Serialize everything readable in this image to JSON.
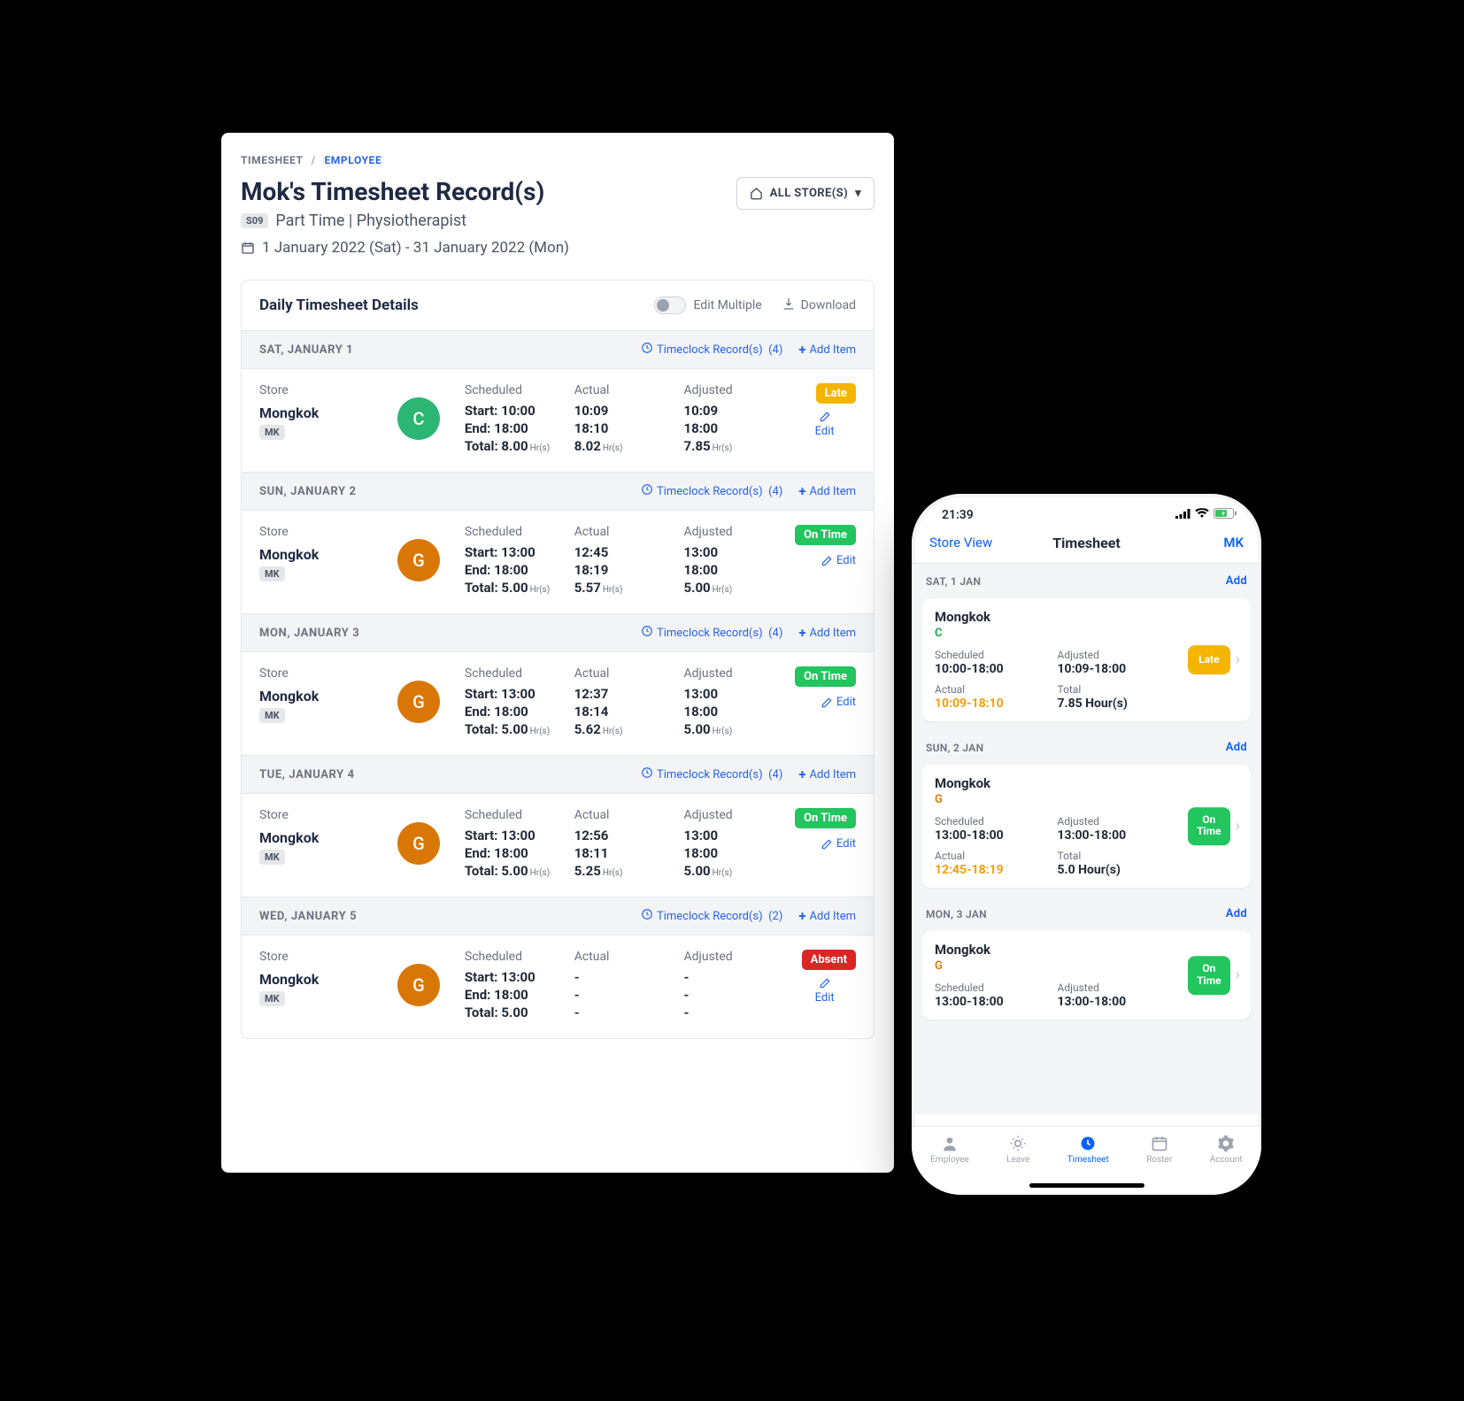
{
  "breadcrumb": {
    "ts": "TIMESHEET",
    "emp": "EMPLOYEE"
  },
  "title": "Mok's Timesheet Record(s)",
  "emp_id": "S09",
  "subtitle": "Part Time | Physiotherapist",
  "date_range": "1 January 2022 (Sat) - 31 January 2022 (Mon)",
  "store_filter": "ALL STORE(S)",
  "card": {
    "title": "Daily Timesheet Details",
    "edit_multiple": "Edit Multiple",
    "download": "Download"
  },
  "labels": {
    "store": "Store",
    "scheduled": "Scheduled",
    "actual": "Actual",
    "adjusted": "Adjusted",
    "start": "Start:",
    "end": "End:",
    "total": "Total:",
    "edit": "Edit",
    "add_item": "Add Item",
    "timeclock_prefix": "Timeclock Record(s)",
    "hrs": "Hr(s)"
  },
  "days": [
    {
      "header": "SAT, JANUARY 1",
      "tc_count": "(4)",
      "store": "Mongkok",
      "store_code": "MK",
      "avatar": "C",
      "avatar_class": "av-green",
      "scheduled": {
        "start": "10:00",
        "end": "18:00",
        "total": "8.00"
      },
      "actual": {
        "start": "10:09",
        "end": "18:10",
        "total": "8.02"
      },
      "adjusted": {
        "start": "10:09",
        "end": "18:00",
        "total": "7.85"
      },
      "status": "Late",
      "status_class": "late",
      "edit_stacked": true
    },
    {
      "header": "SUN, JANUARY 2",
      "tc_count": "(4)",
      "store": "Mongkok",
      "store_code": "MK",
      "avatar": "G",
      "avatar_class": "av-orange",
      "scheduled": {
        "start": "13:00",
        "end": "18:00",
        "total": "5.00"
      },
      "actual": {
        "start": "12:45",
        "end": "18:19",
        "total": "5.57"
      },
      "adjusted": {
        "start": "13:00",
        "end": "18:00",
        "total": "5.00"
      },
      "status": "On Time",
      "status_class": "ontime",
      "edit_stacked": false
    },
    {
      "header": "MON, JANUARY 3",
      "tc_count": "(4)",
      "store": "Mongkok",
      "store_code": "MK",
      "avatar": "G",
      "avatar_class": "av-orange",
      "scheduled": {
        "start": "13:00",
        "end": "18:00",
        "total": "5.00"
      },
      "actual": {
        "start": "12:37",
        "end": "18:14",
        "total": "5.62"
      },
      "adjusted": {
        "start": "13:00",
        "end": "18:00",
        "total": "5.00"
      },
      "status": "On Time",
      "status_class": "ontime",
      "edit_stacked": false
    },
    {
      "header": "TUE, JANUARY 4",
      "tc_count": "(4)",
      "store": "Mongkok",
      "store_code": "MK",
      "avatar": "G",
      "avatar_class": "av-orange",
      "scheduled": {
        "start": "13:00",
        "end": "18:00",
        "total": "5.00"
      },
      "actual": {
        "start": "12:56",
        "end": "18:11",
        "total": "5.25"
      },
      "adjusted": {
        "start": "13:00",
        "end": "18:00",
        "total": "5.00"
      },
      "status": "On Time",
      "status_class": "ontime",
      "edit_stacked": false
    },
    {
      "header": "WED, JANUARY 5",
      "tc_count": "(2)",
      "store": "Mongkok",
      "store_code": "MK",
      "avatar": "G",
      "avatar_class": "av-orange",
      "scheduled": {
        "start": "13:00",
        "end": "18:00",
        "total": "5.00"
      },
      "actual": {
        "start": "-",
        "end": "-",
        "total": "-"
      },
      "adjusted": {
        "start": "-",
        "end": "-",
        "total": "-"
      },
      "status": "Absent",
      "status_class": "absent",
      "edit_stacked": true,
      "no_hrs": true
    }
  ],
  "phone": {
    "time": "21:39",
    "nav_left": "Store View",
    "nav_title": "Timesheet",
    "nav_right": "MK",
    "add": "Add",
    "labels": {
      "scheduled": "Scheduled",
      "adjusted": "Adjusted",
      "actual": "Actual",
      "total": "Total"
    },
    "days": [
      {
        "header": "SAT, 1 JAN",
        "store": "Mongkok",
        "code": "C",
        "code_class": "c",
        "scheduled": "10:00-18:00",
        "adjusted": "10:09-18:00",
        "actual": "10:09-18:10",
        "total": "7.85 Hour(s)",
        "status_lines": [
          "Late"
        ],
        "status_class": "late"
      },
      {
        "header": "SUN, 2 JAN",
        "store": "Mongkok",
        "code": "G",
        "code_class": "g",
        "scheduled": "13:00-18:00",
        "adjusted": "13:00-18:00",
        "actual": "12:45-18:19",
        "total": "5.0 Hour(s)",
        "status_lines": [
          "On",
          "Time"
        ],
        "status_class": "ontime"
      },
      {
        "header": "MON, 3 JAN",
        "store": "Mongkok",
        "code": "G",
        "code_class": "g",
        "scheduled": "13:00-18:00",
        "adjusted": "13:00-18:00",
        "actual": "",
        "total": "",
        "status_lines": [
          "On",
          "Time"
        ],
        "status_class": "ontime",
        "truncated": true
      }
    ],
    "tabs": [
      {
        "label": "Employee"
      },
      {
        "label": "Leave"
      },
      {
        "label": "Timesheet",
        "active": true
      },
      {
        "label": "Roster"
      },
      {
        "label": "Account"
      }
    ]
  }
}
